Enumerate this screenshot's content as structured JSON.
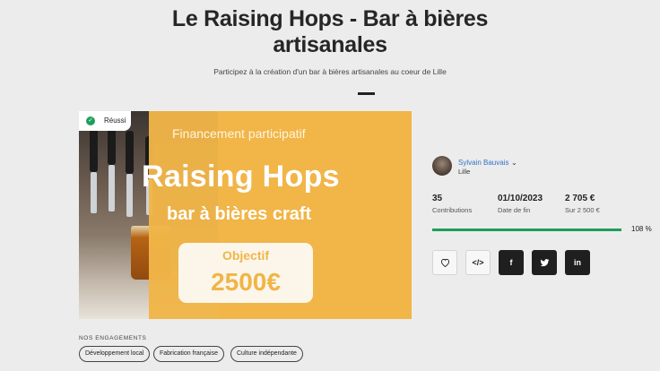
{
  "page": {
    "title": "Le Raising Hops - Bar à bières artisanales",
    "subtitle": "Participez à la création d'un bar à bières artisanales au coeur de Lille"
  },
  "status_badge": {
    "label": "Réussi",
    "icon": "check-circle-icon"
  },
  "media": {
    "subheading": "Financement participatif",
    "heading": "Raising Hops",
    "tagline": "bar à bières craft",
    "goal_label": "Objectif",
    "goal_value": "2500€",
    "colors": {
      "background": "#f0b548",
      "card": "#fcf6ea"
    }
  },
  "engagements": {
    "label": "NOS ENGAGEMENTS",
    "tags": [
      "Développement local",
      "Fabrication française",
      "Culture indépendante"
    ]
  },
  "author": {
    "name": "Sylvain Bauvais",
    "location": "Lille"
  },
  "stats": [
    {
      "value": "35",
      "label": "Contributions"
    },
    {
      "value": "01/10/2023",
      "label": "Date de fin"
    },
    {
      "value": "2 705 €",
      "label": "Sur 2 500 €"
    }
  ],
  "progress": {
    "percent": 108,
    "label": "108 %",
    "color": "#1e9e5a"
  },
  "share": {
    "like_icon": "heart-icon",
    "embed_label": "</>",
    "facebook_label": "f",
    "twitter_icon": "twitter-icon",
    "linkedin_label": "in"
  }
}
